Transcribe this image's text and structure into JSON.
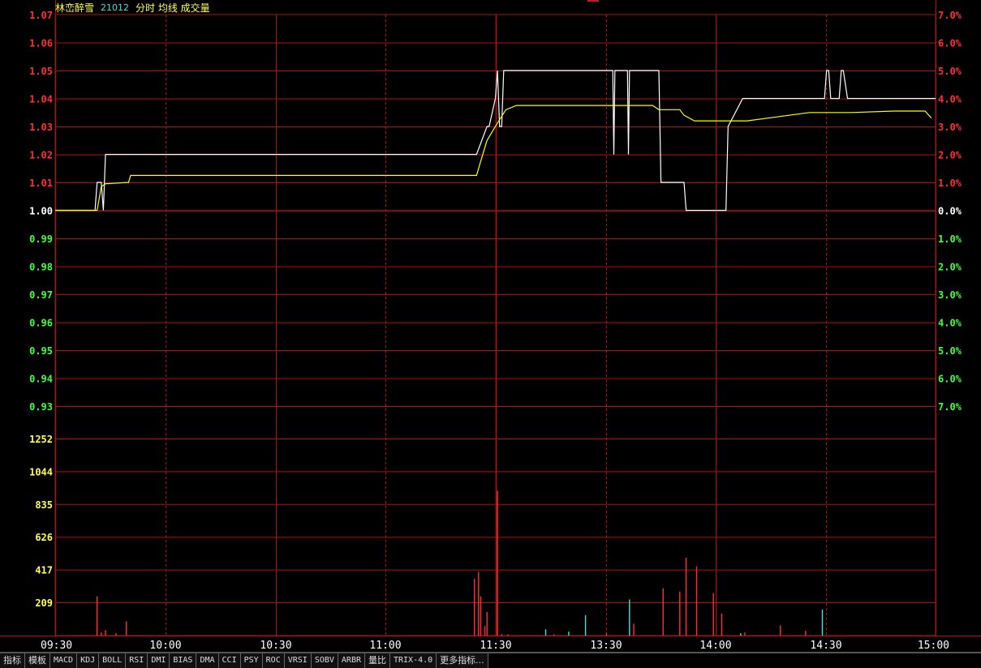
{
  "header": {
    "stock_name": "林峦醉雪",
    "code": "21012",
    "title": "分时 均线 成交量"
  },
  "tabs": [
    "指标",
    "模板",
    "MACD",
    "KDJ",
    "BOLL",
    "RSI",
    "DMI",
    "BIAS",
    "DMA",
    "CCI",
    "PSY",
    "ROC",
    "VRSI",
    "SOBV",
    "ARBR",
    "量比",
    "TRIX-4.0",
    "更多指标..."
  ],
  "colors": {
    "price_line": "#ffffff",
    "avg_line": "#ffff00",
    "grid": "#b01010",
    "up": "#ff3030",
    "down": "#40ff40",
    "volume_up": "#ff3030",
    "volume_down": "#40e0e0",
    "axis_label_yellow": "#ffff55"
  },
  "chart_data": [
    {
      "type": "line",
      "base_price": 1.0,
      "y_ticks_left": [
        "1.07",
        "1.06",
        "1.05",
        "1.04",
        "1.03",
        "1.02",
        "1.01",
        "1.00",
        "0.99",
        "0.98",
        "0.97",
        "0.96",
        "0.95",
        "0.94",
        "0.93"
      ],
      "y_ticks_right": [
        "7.0%",
        "6.0%",
        "5.0%",
        "4.0%",
        "3.0%",
        "2.0%",
        "1.0%",
        "0.0%",
        "1.0%",
        "2.0%",
        "3.0%",
        "4.0%",
        "5.0%",
        "6.0%",
        "7.0%"
      ],
      "ylim": [
        0.93,
        1.07
      ],
      "x_ticks": [
        "09:30",
        "10:00",
        "10:30",
        "11:00",
        "11:30",
        "13:30",
        "14:00",
        "14:30",
        "15:00"
      ],
      "x_tick_minutes": [
        0,
        30,
        60,
        90,
        120,
        150,
        180,
        210,
        240
      ],
      "series": [
        {
          "x": [
            0,
            19,
            20,
            22,
            23,
            24,
            200,
            201,
            206,
            207,
            210,
            211,
            212,
            213,
            214,
            215,
            218,
            219,
            265,
            266,
            266.5,
            267,
            268,
            272,
            273,
            273.5,
            274,
            275,
            276,
            279,
            280,
            287,
            288,
            288.5,
            289,
            290,
            291,
            298,
            299,
            300,
            301,
            305,
            306,
            311,
            312,
            319,
            320,
            321,
            328,
            329,
            330,
            335,
            336,
            346,
            347,
            366,
            367,
            368,
            369,
            370,
            371,
            373,
            374,
            375,
            376,
            378,
            380,
            382,
            385,
            390,
            395,
            404,
            405,
            420
          ],
          "y": [
            1.0,
            1.0,
            1.01,
            1.01,
            1.0,
            1.02,
            1.02,
            1.02,
            1.03,
            1.03,
            1.04,
            1.05,
            1.03,
            1.03,
            1.05,
            1.05,
            1.05,
            1.05,
            1.05,
            1.05,
            1.02,
            1.05,
            1.05,
            1.05,
            1.05,
            1.02,
            1.05,
            1.05,
            1.05,
            1.05,
            1.05,
            1.05,
            1.05,
            1.03,
            1.01,
            1.01,
            1.01,
            1.01,
            1.01,
            1.01,
            1.0,
            1.0,
            1.0,
            1.0,
            1.0,
            1.0,
            1.0,
            1.03,
            1.04,
            1.04,
            1.04,
            1.04,
            1.04,
            1.04,
            1.04,
            1.04,
            1.04,
            1.05,
            1.05,
            1.04,
            1.04,
            1.04,
            1.04,
            1.05,
            1.05,
            1.04,
            1.04,
            1.04,
            1.04,
            1.04,
            1.04,
            1.04,
            1.04,
            1.04
          ]
        },
        {
          "x": [
            0,
            20,
            22,
            24,
            35,
            36,
            200,
            201,
            203,
            206,
            210,
            215,
            220,
            240,
            260,
            270,
            285,
            288,
            291,
            298,
            300,
            305,
            320,
            325,
            330,
            340,
            350,
            360,
            380,
            400,
            415,
            418
          ],
          "y": [
            1.0,
            1.0,
            1.0085,
            1.0095,
            1.01,
            1.0125,
            1.0125,
            1.0125,
            1.0175,
            1.025,
            1.03,
            1.036,
            1.0375,
            1.0375,
            1.0375,
            1.0375,
            1.0375,
            1.036,
            1.036,
            1.036,
            1.034,
            1.032,
            1.032,
            1.032,
            1.032,
            1.033,
            1.034,
            1.035,
            1.035,
            1.0355,
            1.0355,
            1.033
          ]
        }
      ]
    },
    {
      "type": "bar",
      "y_ticks": [
        "1252",
        "1044",
        "835",
        "626",
        "417",
        "209"
      ],
      "ylim": [
        0,
        1252
      ],
      "series": [
        {
          "x": [
            20,
            22,
            24,
            29,
            34,
            200,
            202,
            203,
            205,
            206,
            211,
            213,
            216,
            234,
            238,
            245,
            253,
            263,
            274,
            276,
            290,
            298,
            301,
            306,
            314,
            318,
            327,
            329,
            346,
            358,
            366
          ],
          "values": [
            250,
            20,
            35,
            15,
            90,
            360,
            405,
            250,
            60,
            150,
            920,
            10,
            8,
            40,
            8,
            25,
            130,
            18,
            230,
            75,
            300,
            280,
            495,
            440,
            270,
            140,
            15,
            20,
            65,
            30,
            165
          ],
          "up": [
            true,
            true,
            true,
            true,
            true,
            true,
            true,
            true,
            true,
            true,
            true,
            true,
            true,
            false,
            true,
            false,
            false,
            true,
            false,
            true,
            true,
            true,
            true,
            true,
            true,
            true,
            false,
            true,
            true,
            true,
            false
          ]
        }
      ]
    }
  ]
}
